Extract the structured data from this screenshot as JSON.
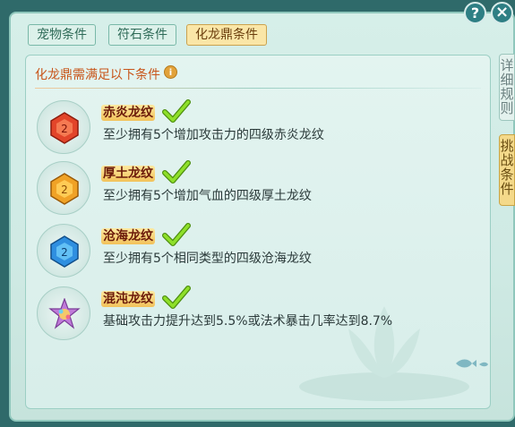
{
  "tabs": [
    {
      "label": "宠物条件",
      "active": false
    },
    {
      "label": "符石条件",
      "active": false
    },
    {
      "label": "化龙鼎条件",
      "active": true
    }
  ],
  "side_tabs": [
    "详细规则",
    "挑战条件"
  ],
  "section": {
    "title": "化龙鼎需满足以下条件",
    "info_icon": "i"
  },
  "conditions": [
    {
      "name": "赤炎龙纹",
      "desc": "至少拥有5个增加攻击力的四级赤炎龙纹",
      "met": true,
      "gem_color": "#e2452a",
      "icon": "red-gem-icon"
    },
    {
      "name": "厚土龙纹",
      "desc": "至少拥有5个增加气血的四级厚土龙纹",
      "met": true,
      "gem_color": "#f0a226",
      "icon": "orange-gem-icon"
    },
    {
      "name": "沧海龙纹",
      "desc": "至少拥有5个相同类型的四级沧海龙纹",
      "met": true,
      "gem_color": "#2f8fe0",
      "icon": "blue-gem-icon"
    },
    {
      "name": "混沌龙纹",
      "desc": "基础攻击力提升达到5.5%或法术暴击几率达到8.7%",
      "met": true,
      "gem_color": "#c07ad8",
      "icon": "rainbow-gem-icon"
    }
  ],
  "buttons": {
    "help": "?",
    "close": "×"
  },
  "colors": {
    "accent": "#c8561b",
    "check": "#7cc61e",
    "active_tab": "#fae6a7"
  }
}
